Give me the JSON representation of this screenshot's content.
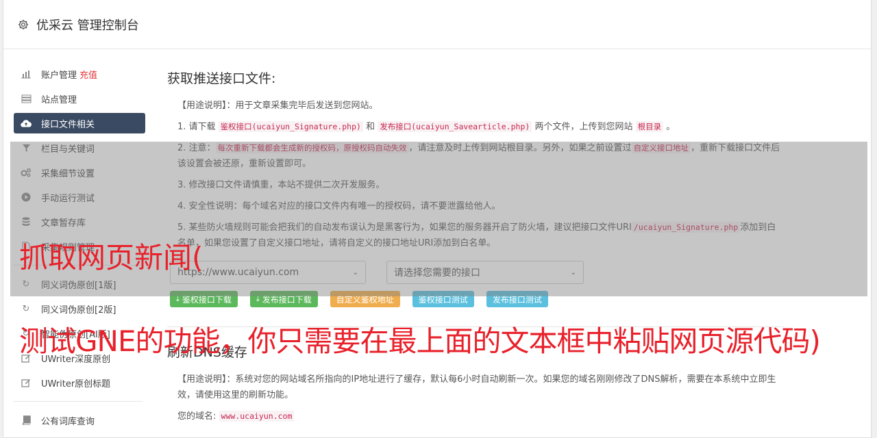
{
  "header": {
    "title": "优采云 管理控制台",
    "icon": "gear-icon"
  },
  "sidebar": {
    "items": [
      {
        "label": "账户管理",
        "extra": "充值",
        "icon": "bar-chart-icon"
      },
      {
        "label": "站点管理",
        "icon": "server-icon"
      },
      {
        "label": "接口文件相关",
        "icon": "cloud-upload-icon",
        "active": true
      },
      {
        "label": "栏目与关键词",
        "icon": "filter-icon"
      },
      {
        "label": "采集细节设置",
        "icon": "cogs-icon"
      },
      {
        "label": "手动运行测试",
        "icon": "play-icon"
      },
      {
        "label": "文章暂存库",
        "icon": "database-icon"
      },
      {
        "label": "采集规则管理",
        "icon": "file-icon"
      },
      {
        "label": "同义词伪原创[1版]",
        "icon": "refresh-icon"
      },
      {
        "label": "同义词伪原创[2版]",
        "icon": "refresh-icon"
      },
      {
        "label": "智能伪原创[AI版]",
        "icon": "refresh-icon"
      },
      {
        "label": "UWriter深度原创",
        "icon": "edit-icon"
      },
      {
        "label": "UWriter原创标题",
        "icon": "edit-icon"
      },
      {
        "label": "公有词库查询",
        "icon": "book-icon"
      }
    ]
  },
  "main": {
    "section1": {
      "title": "获取推送接口文件:",
      "usage_label": "【用途说明】",
      "usage_text": "：用于文章采集完毕后发送到您网站。",
      "p1_a": "1. 请下载",
      "p1_code1": "鉴权接口(ucaiyun_Signature.php)",
      "p1_b": "和",
      "p1_code2": "发布接口(ucaiyun_Savearticle.php)",
      "p1_c": "两个文件，上传到您网站",
      "p1_code3": "根目录",
      "p1_d": "。",
      "p2_a": "2. 注意：",
      "p2_code1": "每次重新下载都会生成新的授权码，原授权码自动失效",
      "p2_b": "，请注意及时上传到网站根目录。另外，如果之前设置过",
      "p2_code2": "自定义接口地址",
      "p2_c": "，重新下载接口文件后该设置会被还原，重新设置即可。",
      "p3": "3. 修改接口文件请慎重，本站不提供二次开发服务。",
      "p4": "4. 安全性说明：每个域名对应的接口文件内有唯一的授权码，请不要泄露给他人。",
      "p5_a": "5. 某些防火墙规则可能会把我们的自动发布误认为是黑客行为，如果您的服务器开启了防火墙，建议把接口文件URI",
      "p5_code": "/ucaiyun_Signature.php",
      "p5_b": "添加到白名单，如果您设置了自定义接口地址，请将自定义的接口地址URI添加到白名单。",
      "select_site": "https://www.ucaiyun.com",
      "select_api": "请选择您需要的接口",
      "buttons": {
        "dl_sign": "鉴权接口下载",
        "dl_publish": "发布接口下载",
        "custom_sign": "自定义鉴权地址",
        "test_sign": "鉴权接口测试",
        "test_publish": "发布接口测试"
      }
    },
    "section2": {
      "title": "刷新DNS缓存",
      "usage_label": "【用途说明】",
      "usage_text": "：系统对您的网站域名所指向的IP地址进行了缓存，默认每6小时自动刷新一次。如果您的域名刚刚修改了DNS解析，需要在本系统中立即生效，请使用这里的刷新功能。",
      "domain_label": "您的域名:",
      "domain_value": "www.ucaiyun.com"
    }
  },
  "overlay_captions": {
    "line1": "抓取网页新闻(",
    "line2": "测试GNE的功能，你只需要在最上面的文本框中粘贴网页源代码)"
  },
  "colors": {
    "accent": "#3b4a63",
    "caption": "#e8212b",
    "green": "#5cb85c",
    "orange": "#f0ad4e",
    "blue": "#5bc0de"
  }
}
